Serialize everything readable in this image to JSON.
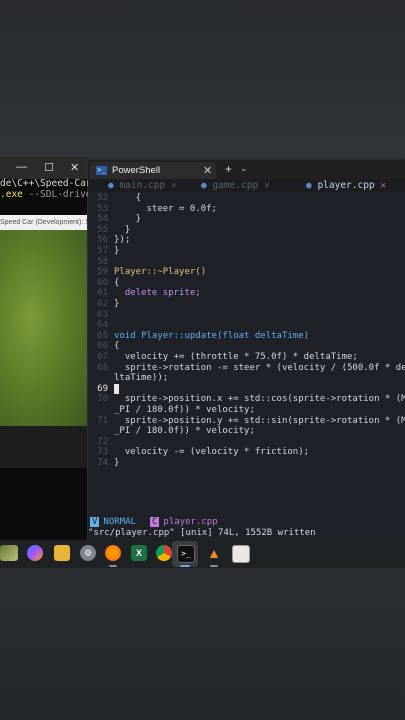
{
  "console": {
    "title_min": "—",
    "title_max": "☐",
    "title_close": "✕",
    "path_line": "de\\C++\\Speed-Car",
    "exe_line": ".exe",
    "exe_args": " --SDL-drive"
  },
  "game_window": {
    "title": "Speed Car (Development): SDL"
  },
  "terminal": {
    "tab_title": "PowerShell",
    "tab_close": "✕",
    "new_tab": "+",
    "dropdown": "⌄"
  },
  "buffers": [
    {
      "name": "main.cpp",
      "close": "✕",
      "active": false
    },
    {
      "name": "game.cpp",
      "close": "✕",
      "active": false
    },
    {
      "name": "player.cpp",
      "close": "✕",
      "active": true
    }
  ],
  "code_lines": [
    {
      "n": "52",
      "text": "    {"
    },
    {
      "n": "53",
      "text": "      steer = 0.0f;"
    },
    {
      "n": "54",
      "text": "    }"
    },
    {
      "n": "55",
      "text": "  }"
    },
    {
      "n": "56",
      "text": "});"
    },
    {
      "n": "57",
      "text": "}"
    },
    {
      "n": "58",
      "text": ""
    },
    {
      "n": "59",
      "text": "Player::~Player()"
    },
    {
      "n": "60",
      "text": "{"
    },
    {
      "n": "61",
      "text": "  delete sprite;"
    },
    {
      "n": "62",
      "text": "}"
    },
    {
      "n": "63",
      "text": ""
    },
    {
      "n": "64",
      "text": ""
    },
    {
      "n": "65",
      "text": "void Player::update(float deltaTime)"
    },
    {
      "n": "66",
      "text": "{"
    },
    {
      "n": "67",
      "text": "  velocity += (throttle * 75.0f) * deltaTime;"
    },
    {
      "n": "68",
      "text": "  sprite->rotation -= steer * (velocity / (500.0f * de"
    },
    {
      "n": "",
      "text": "ltaTime));"
    },
    {
      "n": "69",
      "text": ""
    },
    {
      "n": "70",
      "text": "  sprite->position.x += std::cos(sprite->rotation * (M"
    },
    {
      "n": "",
      "text": "_PI / 180.0f)) * velocity;"
    },
    {
      "n": "71",
      "text": "  sprite->position.y += std::sin(sprite->rotation * (M"
    },
    {
      "n": "",
      "text": "_PI / 180.0f)) * velocity;"
    },
    {
      "n": "72",
      "text": ""
    },
    {
      "n": "73",
      "text": "  velocity -= (velocity * friction);"
    },
    {
      "n": "74",
      "text": "}"
    }
  ],
  "statusline": {
    "mode": "NORMAL",
    "file": "player.cpp",
    "message": "\"src/player.cpp\" [unix] 74L, 1552B written"
  },
  "taskbar": {
    "icons": [
      "landscape-icon",
      "copilot-icon",
      "file-explorer-icon",
      "settings-icon",
      "firefox-icon",
      "excel-icon",
      "chrome-icon",
      "terminal-icon",
      "vlc-icon",
      "app-window-icon"
    ]
  }
}
